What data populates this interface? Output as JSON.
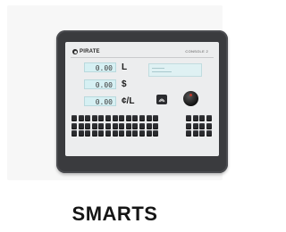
{
  "product": {
    "brand": "PIRATE",
    "console_label": "CONSOLE 2",
    "readouts": [
      {
        "value": "0.00",
        "unit": "L"
      },
      {
        "value": "0.00",
        "unit": "$"
      },
      {
        "value": "0.00",
        "unit": "¢/L"
      }
    ],
    "caption": "SMARTS"
  },
  "keypad": {
    "left_rows": 3,
    "left_cols": 13,
    "right_rows": 3,
    "right_cols": 4
  },
  "icons": [
    "brand-logo-icon",
    "fuel-grade-icon",
    "selector-knob-icon"
  ]
}
